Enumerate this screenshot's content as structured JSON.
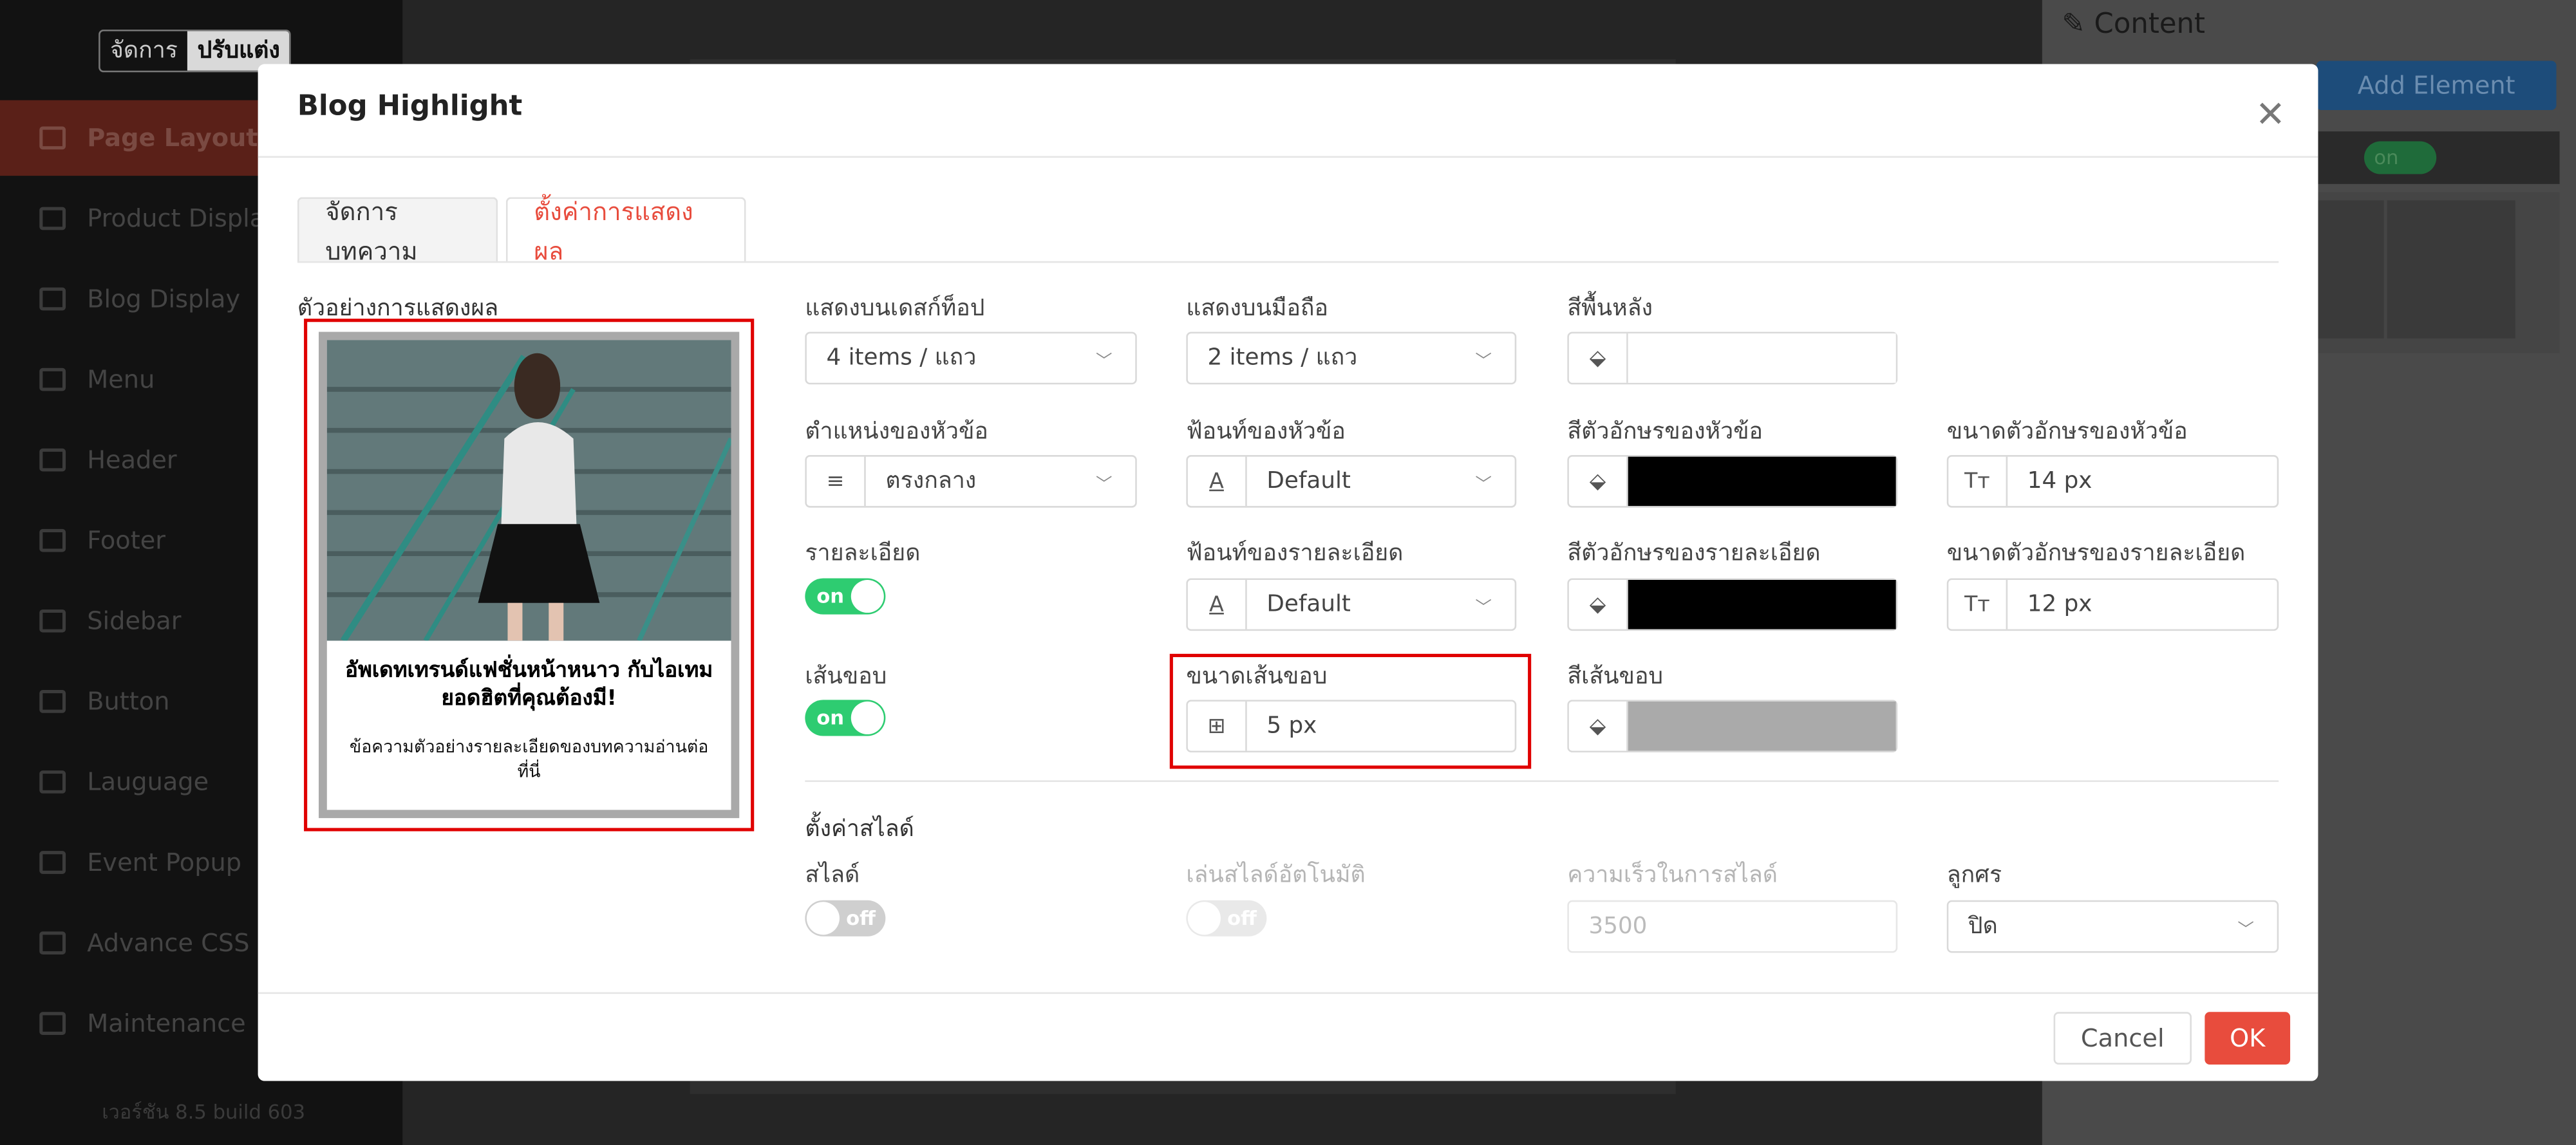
{
  "app": {
    "mode_toggle": [
      "จัดการ",
      "ปรับแต่ง"
    ],
    "nav_items": [
      "Page Layouts",
      "Product Displa",
      "Blog Display",
      "Menu",
      "Header",
      "Footer",
      "Sidebar",
      "Button",
      "Lauguage",
      "Event Popup",
      "Advance CSS",
      "Maintenance"
    ],
    "version": "เวอร์ชัน 8.5 build 603",
    "right_panel": {
      "title": "Content",
      "add_button": "Add Element",
      "toggle_label": "on"
    }
  },
  "modal": {
    "title": "Blog Highlight",
    "tabs": [
      "จัดการบทความ",
      "ตั้งค่าการแสดงผล"
    ],
    "active_tab": 1,
    "preview": {
      "label": "ตัวอย่างการแสดงผล",
      "title": "อัพเดทเทรนด์แฟชั่นหน้าหนาว กับไอเทมยอดฮิตที่คุณต้องมี!",
      "description": "ข้อความตัวอย่างรายละเอียดของบทความอ่านต่อที่นี่"
    },
    "fields": {
      "desktop_label": "แสดงบนเดสก์ท็อป",
      "desktop_value": "4 items / แถว",
      "mobile_label": "แสดงบนมือถือ",
      "mobile_value": "2 items / แถว",
      "bg_label": "สีพื้นหลัง",
      "bg_color": "#ffffff",
      "title_pos_label": "ตำแหน่งของหัวข้อ",
      "title_pos_value": "ตรงกลาง",
      "title_font_label": "ฟ้อนท์ของหัวข้อ",
      "title_font_value": "Default",
      "title_color_label": "สีตัวอักษรของหัวข้อ",
      "title_color": "#000000",
      "title_size_label": "ขนาดตัวอักษรของหัวข้อ",
      "title_size_value": "14 px",
      "detail_label": "รายละเอียด",
      "detail_toggle": "on",
      "detail_font_label": "ฟ้อนท์ของรายละเอียด",
      "detail_font_value": "Default",
      "detail_color_label": "สีตัวอักษรของรายละเอียด",
      "detail_color": "#000000",
      "detail_size_label": "ขนาดตัวอักษรของรายละเอียด",
      "detail_size_value": "12 px",
      "border_label": "เส้นขอบ",
      "border_toggle": "on",
      "border_width_label": "ขนาดเส้นขอบ",
      "border_width_value": "5 px",
      "border_color_label": "สีเส้นขอบ",
      "border_color": "#aaaaaa"
    },
    "slide": {
      "section_title": "ตั้งค่าสไลด์",
      "slide_label": "สไลด์",
      "slide_toggle": "off",
      "autoplay_label": "เล่นสไลด์อัตโนมัติ",
      "autoplay_toggle": "off",
      "speed_label": "ความเร็วในการสไลด์",
      "speed_placeholder": "3500",
      "arrow_label": "ลูกศร",
      "arrow_value": "ปิด"
    },
    "buttons": {
      "cancel": "Cancel",
      "ok": "OK"
    }
  },
  "colors": {
    "accent": "#e84c3d",
    "toggle_on": "#2ecc71",
    "highlight": "#e00000"
  }
}
